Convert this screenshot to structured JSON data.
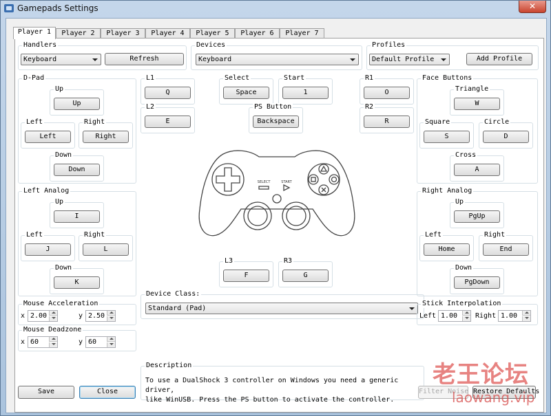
{
  "window": {
    "title": "Gamepads Settings",
    "close_glyph": "✕"
  },
  "tabs": [
    "Player 1",
    "Player 2",
    "Player 3",
    "Player 4",
    "Player 5",
    "Player 6",
    "Player 7"
  ],
  "handlers": {
    "title": "Handlers",
    "selected": "Keyboard",
    "refresh": "Refresh"
  },
  "devices": {
    "title": "Devices",
    "selected": "Keyboard"
  },
  "profiles": {
    "title": "Profiles",
    "selected": "Default Profile",
    "add": "Add Profile"
  },
  "dpad": {
    "title": "D-Pad",
    "up_label": "Up",
    "up_key": "Up",
    "left_label": "Left",
    "left_key": "Left",
    "right_label": "Right",
    "right_key": "Right",
    "down_label": "Down",
    "down_key": "Down"
  },
  "left_analog": {
    "title": "Left Analog",
    "up_label": "Up",
    "up_key": "I",
    "left_label": "Left",
    "left_key": "J",
    "right_label": "Right",
    "right_key": "L",
    "down_label": "Down",
    "down_key": "K"
  },
  "l1": {
    "label": "L1",
    "key": "Q"
  },
  "l2": {
    "label": "L2",
    "key": "E"
  },
  "select": {
    "label": "Select",
    "key": "Space"
  },
  "start": {
    "label": "Start",
    "key": "1"
  },
  "ps_button": {
    "label": "PS Button",
    "key": "Backspace"
  },
  "r1": {
    "label": "R1",
    "key": "O"
  },
  "r2": {
    "label": "R2",
    "key": "R"
  },
  "l3": {
    "label": "L3",
    "key": "F"
  },
  "r3": {
    "label": "R3",
    "key": "G"
  },
  "face": {
    "title": "Face Buttons",
    "triangle_label": "Triangle",
    "triangle_key": "W",
    "square_label": "Square",
    "square_key": "S",
    "circle_label": "Circle",
    "circle_key": "D",
    "cross_label": "Cross",
    "cross_key": "A"
  },
  "right_analog": {
    "title": "Right Analog",
    "up_label": "Up",
    "up_key": "PgUp",
    "left_label": "Left",
    "left_key": "Home",
    "right_label": "Right",
    "right_key": "End",
    "down_label": "Down",
    "down_key": "PgDown"
  },
  "controller_image": {
    "select_text": "SELECT",
    "start_text": "START"
  },
  "mouse_accel": {
    "title": "Mouse Acceleration",
    "x_label": "x",
    "x_value": "2.00",
    "y_label": "y",
    "y_value": "2.50"
  },
  "mouse_dead": {
    "title": "Mouse Deadzone",
    "x_label": "x",
    "x_value": "60",
    "y_label": "y",
    "y_value": "60"
  },
  "device_class": {
    "title": "Device Class:",
    "selected": "Standard (Pad)"
  },
  "stick_interp": {
    "title": "Stick Interpolation",
    "left_label": "Left",
    "left_value": "1.00",
    "right_label": "Right",
    "right_value": "1.00"
  },
  "description": {
    "title": "Description",
    "text": "To use a DualShock 3 controller on Windows you need a generic driver,\nlike WinUSB. Press the PS button to activate the controller."
  },
  "footer": {
    "save": "Save",
    "close": "Close",
    "filter_noise": "Filter Noise",
    "restore": "Restore Defaults"
  },
  "watermark": {
    "line1": "老王论坛",
    "line2": "laowang.vip"
  }
}
